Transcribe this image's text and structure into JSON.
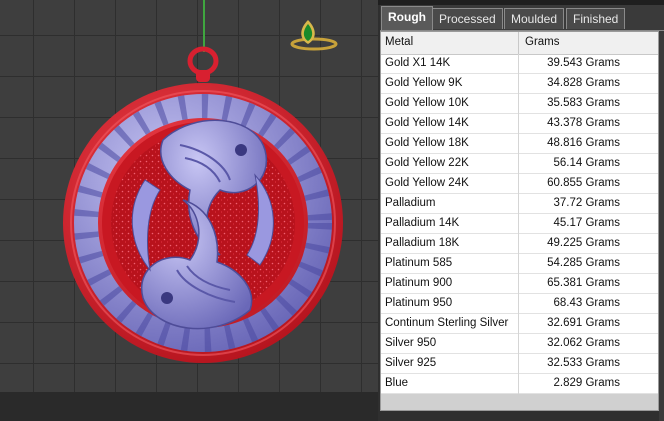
{
  "tabs": [
    {
      "label": "Rough",
      "active": true
    },
    {
      "label": "Processed",
      "active": false
    },
    {
      "label": "Moulded",
      "active": false
    },
    {
      "label": "Finished",
      "active": false
    }
  ],
  "table": {
    "headers": [
      "Metal",
      "Grams"
    ],
    "rows": [
      {
        "metal": "Gold X1 14K",
        "grams": "39.543 Grams"
      },
      {
        "metal": "Gold Yellow 9K",
        "grams": "34.828 Grams"
      },
      {
        "metal": "Gold Yellow 10K",
        "grams": "35.583 Grams"
      },
      {
        "metal": "Gold Yellow 14K",
        "grams": "43.378 Grams"
      },
      {
        "metal": "Gold Yellow 18K",
        "grams": "48.816 Grams"
      },
      {
        "metal": "Gold Yellow 22K",
        "grams": "56.14 Grams"
      },
      {
        "metal": "Gold Yellow 24K",
        "grams": "60.855 Grams"
      },
      {
        "metal": "Palladium",
        "grams": "37.72 Grams"
      },
      {
        "metal": "Palladium 14K",
        "grams": "45.17 Grams"
      },
      {
        "metal": "Palladium 18K",
        "grams": "49.225 Grams"
      },
      {
        "metal": "Platinum 585",
        "grams": "54.285 Grams"
      },
      {
        "metal": "Platinum 900",
        "grams": "65.381 Grams"
      },
      {
        "metal": "Platinum 950",
        "grams": "68.43 Grams"
      },
      {
        "metal": "Continum Sterling Silver",
        "grams": "32.691 Grams"
      },
      {
        "metal": "Silver 950",
        "grams": "32.062 Grams"
      },
      {
        "metal": "Silver 925",
        "grams": "32.533 Grams"
      },
      {
        "metal": "Blue",
        "grams": "2.829 Grams"
      }
    ]
  },
  "colors": {
    "pendant_red": "#d81e2a",
    "relief_purple": "#8a88d8",
    "gem_green": "#1a8a2a",
    "grid_line": "#2e2e2e",
    "axis_green": "#3fa63f"
  },
  "icons": [
    "ring-thumbnail-icon",
    "pendant-model"
  ]
}
